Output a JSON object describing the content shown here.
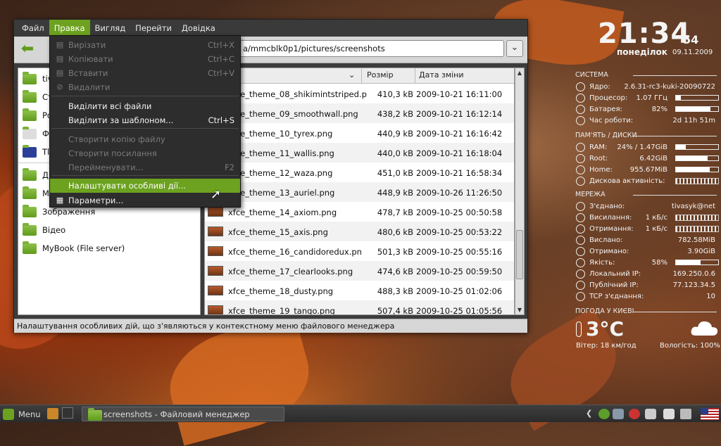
{
  "menubar": [
    "Файл",
    "Правка",
    "Вигляд",
    "Перейти",
    "Довідка"
  ],
  "path": "a/mmcblk0p1/pictures/screenshots",
  "sidebar": {
    "items": [
      {
        "label": "tiv",
        "icon": "home-folder-icon"
      },
      {
        "label": "Ст",
        "icon": "trash-icon"
      },
      {
        "label": "Ро",
        "icon": "desktop-icon"
      },
      {
        "label": "Ф",
        "icon": "drive-icon"
      },
      {
        "label": "Tl",
        "icon": "sd-card-icon"
      },
      {
        "label": "Д",
        "icon": "folder-icon"
      },
      {
        "label": "М",
        "icon": "folder-icon"
      },
      {
        "label": "Зображення",
        "icon": "folder-icon"
      },
      {
        "label": "Відео",
        "icon": "folder-icon"
      },
      {
        "label": "MyBook (File server)",
        "icon": "network-folder-icon"
      }
    ]
  },
  "columns": {
    "size": "Розмір",
    "date": "Дата зміни"
  },
  "files": [
    {
      "name": "xfce_theme_08_shikimintstriped.p",
      "size": "410,3 kB",
      "date": "2009-10-21 16:11:00"
    },
    {
      "name": "xfce_theme_09_smoothwall.png",
      "size": "438,2 kB",
      "date": "2009-10-21 16:12:14"
    },
    {
      "name": "xfce_theme_10_tyrex.png",
      "size": "440,9 kB",
      "date": "2009-10-21 16:16:42"
    },
    {
      "name": "xfce_theme_11_wallis.png",
      "size": "440,0 kB",
      "date": "2009-10-21 16:18:04"
    },
    {
      "name": "xfce_theme_12_waza.png",
      "size": "451,0 kB",
      "date": "2009-10-21 16:58:34"
    },
    {
      "name": "xfce_theme_13_auriel.png",
      "size": "448,9 kB",
      "date": "2009-10-26 11:26:50"
    },
    {
      "name": "xfce_theme_14_axiom.png",
      "size": "478,7 kB",
      "date": "2009-10-25 00:50:58"
    },
    {
      "name": "xfce_theme_15_axis.png",
      "size": "480,6 kB",
      "date": "2009-10-25 00:53:22"
    },
    {
      "name": "xfce_theme_16_candidoredux.pn",
      "size": "501,3 kB",
      "date": "2009-10-25 00:55:16"
    },
    {
      "name": "xfce_theme_17_clearlooks.png",
      "size": "474,6 kB",
      "date": "2009-10-25 00:59:50"
    },
    {
      "name": "xfce_theme_18_dusty.png",
      "size": "488,3 kB",
      "date": "2009-10-25 01:02:06"
    },
    {
      "name": "xfce_theme_19_tango.png",
      "size": "507,4 kB",
      "date": "2009-10-25 01:05:56"
    }
  ],
  "edit_menu": [
    {
      "label": "Вирізати",
      "shortcut": "Ctrl+X",
      "disabled": true,
      "icon": "cut-icon"
    },
    {
      "label": "Копіювати",
      "shortcut": "Ctrl+C",
      "disabled": true,
      "icon": "copy-icon"
    },
    {
      "label": "Вставити",
      "shortcut": "Ctrl+V",
      "disabled": true,
      "icon": "paste-icon"
    },
    {
      "label": "Видалити",
      "shortcut": "",
      "disabled": true,
      "icon": "delete-icon"
    },
    {
      "label": "Виділити всі файли",
      "shortcut": "",
      "disabled": false,
      "icon": ""
    },
    {
      "label": "Виділити за шаблоном...",
      "shortcut": "Ctrl+S",
      "disabled": false,
      "icon": ""
    },
    {
      "label": "Створити копію файлу",
      "shortcut": "",
      "disabled": true,
      "icon": ""
    },
    {
      "label": "Створити посилання",
      "shortcut": "",
      "disabled": true,
      "icon": ""
    },
    {
      "label": "Перейменувати...",
      "shortcut": "F2",
      "disabled": true,
      "icon": ""
    },
    {
      "label": "Налаштувати особливі дії...",
      "shortcut": "",
      "disabled": false,
      "highlighted": true,
      "icon": ""
    },
    {
      "label": "Параметри...",
      "shortcut": "",
      "disabled": false,
      "icon": "preferences-icon"
    }
  ],
  "statusbar": "Налаштування особливих дій, що з'являються у контекстному меню файлового менеджера",
  "conky": {
    "time": "21:34",
    "seconds": "54",
    "weekday": "понеділок",
    "date": "09.11.2009",
    "system_header": "СИСТЕМА",
    "system": [
      {
        "label": "Ядро:",
        "value": "2.6.31-rc3-kuki-20090722"
      },
      {
        "label": "Процесор:",
        "value": "1.07 ГГц"
      },
      {
        "label": "Батарея:",
        "value": "82%"
      },
      {
        "label": "Час роботи:",
        "value": "2d 11h 51m"
      }
    ],
    "disk_header": "ПАМ'ЯТЬ / ДИСКИ",
    "disk": [
      {
        "label": "RAM:",
        "value": "24% / 1.47GiB"
      },
      {
        "label": "Root:",
        "value": "6.42GiB"
      },
      {
        "label": "Home:",
        "value": "955.67MiB"
      },
      {
        "label": "Дискова активність:",
        "value": ""
      }
    ],
    "net_header": "МЕРЕЖА",
    "net": [
      {
        "label": "З'єднано:",
        "value": "tivasyk@net"
      },
      {
        "label": "Висилання:",
        "value": "1 кБ/с"
      },
      {
        "label": "Отримання:",
        "value": "1 кБ/с"
      },
      {
        "label": "Вислано:",
        "value": "782.58MiB"
      },
      {
        "label": "Отримано:",
        "value": "3.90GiB"
      },
      {
        "label": "Якість:",
        "value": "58%"
      },
      {
        "label": "Локальний IP:",
        "value": "169.250.0.6"
      },
      {
        "label": "Публічний IP:",
        "value": "77.123.34.5"
      },
      {
        "label": "TCP з'єднання:",
        "value": "10"
      }
    ],
    "weather_header": "ПОГОДА У КИЄВІ",
    "temperature": "3°C",
    "wind": "Вітер:  18 км/год",
    "humidity": "Вологість:  100%"
  },
  "taskbar": {
    "menu": "Menu",
    "task": "screenshots - Файловий менеджер"
  }
}
